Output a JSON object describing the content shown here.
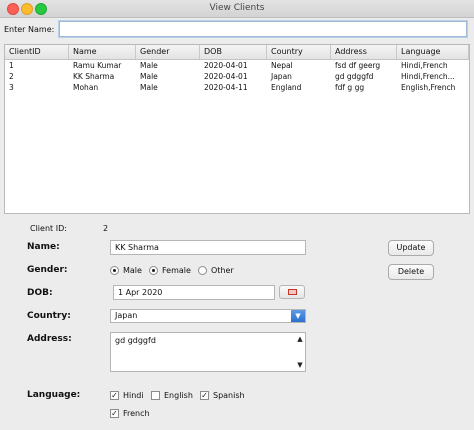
{
  "window": {
    "title": "View Clients"
  },
  "search": {
    "label": "Enter Name:",
    "value": "",
    "placeholder": ""
  },
  "table": {
    "columns": [
      "ClientID",
      "Name",
      "Gender",
      "DOB",
      "Country",
      "Address",
      "Language"
    ],
    "rows": [
      [
        "1",
        "Ramu Kumar",
        "Male",
        "2020-04-01",
        "Nepal",
        "fsd df   geerg",
        "Hindi,French"
      ],
      [
        "2",
        "KK Sharma",
        "Male",
        "2020-04-01",
        "Japan",
        "gd gdggfd",
        "Hindi,French..."
      ],
      [
        "3",
        "Mohan",
        "Male",
        "2020-04-11",
        "England",
        "fdf g gg",
        "English,French"
      ]
    ]
  },
  "form": {
    "client_id_label": "Client ID:",
    "client_id_value": "2",
    "name_label": "Name:",
    "name_value": "KK Sharma",
    "gender_label": "Gender:",
    "gender_options": [
      "Male",
      "Female",
      "Other"
    ],
    "dob_label": "DOB:",
    "dob_value": "1 Apr 2020",
    "country_label": "Country:",
    "country_value": "Japan",
    "address_label": "Address:",
    "address_value": "gd gdggfd",
    "language_label": "Language:",
    "languages": [
      "Hindi",
      "English",
      "Spanish",
      "French"
    ]
  },
  "buttons": {
    "update": "Update",
    "delete": "Delete"
  }
}
